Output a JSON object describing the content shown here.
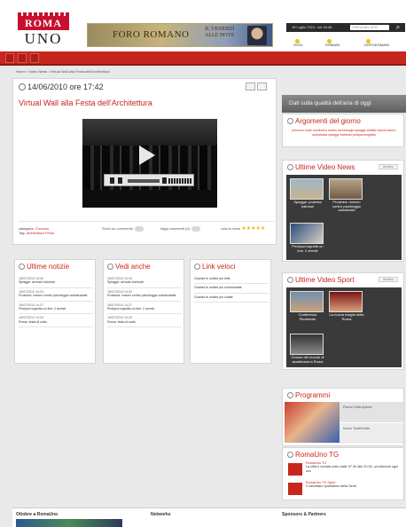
{
  "header": {
    "logo_top": "ROMA",
    "logo_bottom": "UNO",
    "banner_main": "FORO ROMANO",
    "banner_sub_line1": "IL VENERDÌ",
    "banner_sub_line2": "ALLE NOVE",
    "date_text": "18 Luglio 2010, ore 18.48",
    "search_value": "CERCA NEL SITO",
    "links": [
      "OGGI",
      "DOMANI",
      "DOPODOMANI"
    ]
  },
  "breadcrumb": "Home / Video News / Virtual Wall alla Festa dell'Architettura",
  "main": {
    "date": "14/06/2010 ore 17:42",
    "title": "Virtual Wall alla Festa dell'Architettura",
    "category_label": "categoria:",
    "category_value": "Cronaca",
    "tag_label": "Tag:",
    "tag_value": "architettura Festa",
    "actions": {
      "comment": "Scrivi un commento",
      "read": "leggi commenti (0)",
      "vote": "vota la news"
    },
    "rating_stars": 5
  },
  "columns": [
    {
      "title": "Ultime notizie",
      "items": [
        {
          "time": "18/07/2010 14:40",
          "text": "Spiagge: arrivato balneari"
        },
        {
          "time": "18/07/2010 14:33",
          "text": "Prosinea: rosseo contro parcheggio autostradale"
        },
        {
          "time": "18/07/2010 14:27",
          "text": "Pedopornografia on line: 2 arresti"
        },
        {
          "time": "18/07/2010 14:20",
          "text": "Roma: festa di sotto"
        }
      ]
    },
    {
      "title": "Vedi anche",
      "items": [
        {
          "time": "18/07/2010 14:40",
          "text": "Spiagge: arrivato balneari"
        },
        {
          "time": "18/07/2010 14:33",
          "text": "Prosinea: rosseo contro parcheggio autostradale"
        },
        {
          "time": "18/07/2010 14:27",
          "text": "Pedopornografia on line: 2 arresti"
        },
        {
          "time": "18/07/2010 14:20",
          "text": "Roma: festa di sotto"
        }
      ]
    },
    {
      "title": "Link veloci",
      "items": [
        {
          "time": "",
          "text": "Guarda le notizie più lette"
        },
        {
          "time": "",
          "text": "Guarda le notizie più commentate"
        },
        {
          "time": "",
          "text": "Guarda le notizie più votate"
        }
      ]
    }
  ],
  "sidebar": {
    "air_banner": "Dati sulla qualità dell'aria di oggi",
    "argomenti": {
      "title": "Argomenti del giorno",
      "tags": "precorso sulle condizioni meteo archeologia spiagge sfollati marcia lavoro autostrada spiagge balneari pedopornografia"
    },
    "video_news": {
      "title": "Ultime Video News",
      "more": "archivio",
      "items": [
        {
          "caption": "Spiagge: protesta balneari"
        },
        {
          "caption": "Prosinea: rinnovo contro parcheggio autostrada"
        },
        {
          "caption": "Pedopornografia on line: 2 arresti"
        }
      ]
    },
    "video_sport": {
      "title": "Ultime Video Sport",
      "more": "archivio",
      "items": [
        {
          "caption": "Conferenza Riondardo"
        },
        {
          "caption": "La nuova maglia della Roma"
        },
        {
          "caption": "Grosse del mondo di skateboard a Roma"
        }
      ]
    },
    "programmi": {
      "title": "Programmi",
      "rows": [
        "Roma Città Aperta",
        "Ionee TestiMoltre"
      ]
    },
    "tg": {
      "title": "RomaUno TG",
      "items": [
        {
          "head": "RomaUno TG",
          "text": "La città e tornata sotto dalle 07.30 alle 20.30, un'edizione ogni ora"
        },
        {
          "head": "RomaUno TG Sport",
          "text": "Il calcettaro quotidiano della Sera!"
        }
      ]
    }
  },
  "footer": {
    "col1": "Ottobre a RomaUno",
    "col2": "Networks",
    "col3": "Sponsors & Partners"
  },
  "colors": {
    "accent": "#c8261d",
    "logo_red": "#c8102e"
  }
}
